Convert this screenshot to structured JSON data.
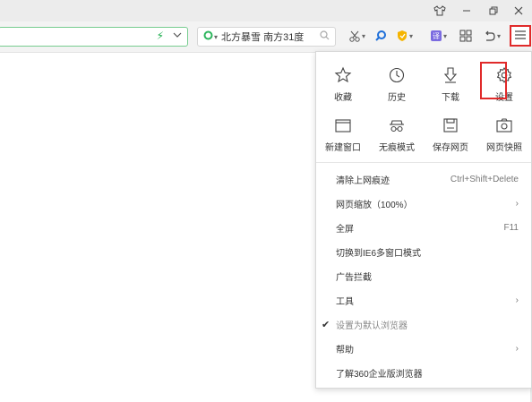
{
  "window": {
    "controls": [
      {
        "name": "skin-icon",
        "glyph": "👕"
      },
      {
        "name": "minimize-icon",
        "glyph": "—"
      },
      {
        "name": "restore-icon",
        "glyph": "❐"
      },
      {
        "name": "close-icon",
        "glyph": "✕"
      }
    ]
  },
  "toolbar": {
    "weather_text": "北方暴雪 南方31度",
    "menu_icon": "hamburger-icon"
  },
  "menu": {
    "grid": [
      {
        "label": "收藏",
        "icon": "star-icon"
      },
      {
        "label": "历史",
        "icon": "clock-icon"
      },
      {
        "label": "下载",
        "icon": "download-icon"
      },
      {
        "label": "设置",
        "icon": "gear-icon"
      },
      {
        "label": "新建窗口",
        "icon": "window-icon"
      },
      {
        "label": "无痕模式",
        "icon": "incognito-icon"
      },
      {
        "label": "保存网页",
        "icon": "save-icon"
      },
      {
        "label": "网页快照",
        "icon": "camera-icon"
      }
    ],
    "items": [
      {
        "label": "清除上网痕迹",
        "right": "Ctrl+Shift+Delete"
      },
      {
        "label": "网页缩放（100%）",
        "right": "›"
      },
      {
        "label": "全屏",
        "right": "F11"
      },
      {
        "label": "切换到IE6多窗口模式",
        "right": ""
      },
      {
        "label": "广告拦截",
        "right": ""
      },
      {
        "label": "工具",
        "right": "›"
      },
      {
        "label": "设置为默认浏览器",
        "right": "",
        "checked": "✔"
      },
      {
        "label": "帮助",
        "right": "›"
      },
      {
        "label": "了解360企业版浏览器",
        "right": ""
      }
    ]
  }
}
